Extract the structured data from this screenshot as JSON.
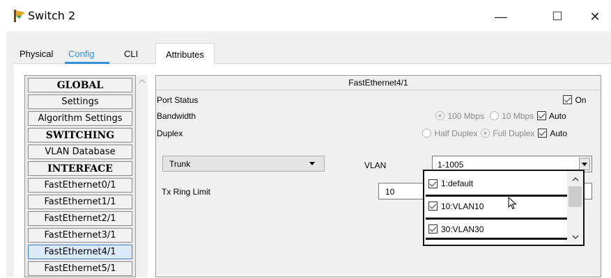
{
  "window": {
    "title": "Switch 2",
    "controls": {
      "minimize": "—",
      "maximize": "☐",
      "close": "✕"
    }
  },
  "tabs": {
    "physical": "Physical",
    "config": "Config",
    "cli": "CLI",
    "attributes": "Attributes"
  },
  "accent_color": "#2f8fd8",
  "sidebar": {
    "items": [
      {
        "label": "GLOBAL",
        "header": true
      },
      {
        "label": "Settings"
      },
      {
        "label": "Algorithm Settings"
      },
      {
        "label": "SWITCHING",
        "header": true
      },
      {
        "label": "VLAN Database"
      },
      {
        "label": "INTERFACE",
        "header": true
      },
      {
        "label": "FastEthernet0/1"
      },
      {
        "label": "FastEthernet1/1"
      },
      {
        "label": "FastEthernet2/1"
      },
      {
        "label": "FastEthernet3/1"
      },
      {
        "label": "FastEthernet4/1",
        "selected": true
      },
      {
        "label": "FastEthernet5/1"
      }
    ]
  },
  "port": {
    "title": "FastEthernet4/1",
    "status": {
      "label": "Port Status",
      "on_label": "On",
      "checked": true
    },
    "bandwidth": {
      "label": "Bandwidth",
      "opt1": "100 Mbps",
      "opt2": "10 Mbps",
      "auto": "Auto"
    },
    "duplex": {
      "label": "Duplex",
      "opt1": "Half Duplex",
      "opt2": "Full Duplex",
      "auto": "Auto"
    },
    "mode": {
      "value": "Trunk"
    },
    "vlan": {
      "label": "VLAN",
      "value": "1-1005",
      "options": [
        "1:default",
        "10:VLAN10",
        "30:VLAN30"
      ]
    },
    "tx_ring": {
      "label": "Tx Ring Limit",
      "value": "10"
    }
  }
}
